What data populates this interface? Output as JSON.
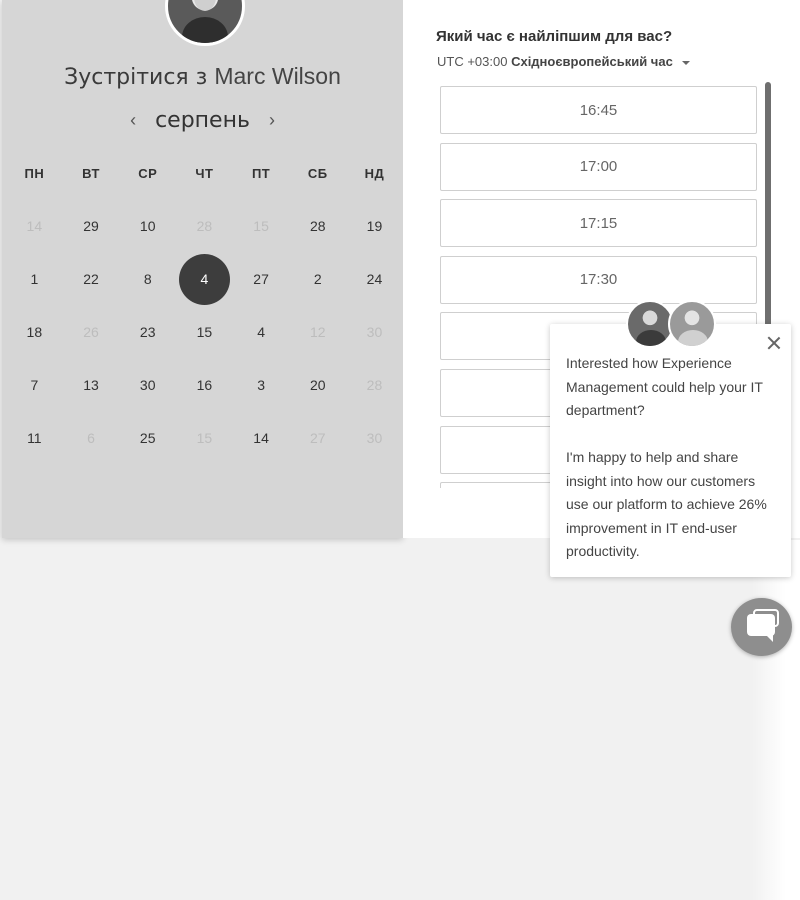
{
  "calendar": {
    "host_prefix": "Зустрітися з",
    "host_name": "Marc Wilson",
    "month": "серпень",
    "prev_arrow": "‹",
    "next_arrow": "›",
    "weekdays": [
      "ПН",
      "ВТ",
      "СР",
      "ЧТ",
      "ПТ",
      "СБ",
      "НД"
    ],
    "rows": [
      [
        {
          "d": "14",
          "m": true
        },
        {
          "d": "29"
        },
        {
          "d": "10"
        },
        {
          "d": "28",
          "m": true
        },
        {
          "d": "15",
          "m": true
        },
        {
          "d": "28"
        },
        {
          "d": "19"
        }
      ],
      [
        {
          "d": "1"
        },
        {
          "d": "22"
        },
        {
          "d": "8"
        },
        {
          "d": "4",
          "sel": true
        },
        {
          "d": "27"
        },
        {
          "d": "2"
        },
        {
          "d": "24"
        }
      ],
      [
        {
          "d": "18"
        },
        {
          "d": "26",
          "m": true
        },
        {
          "d": "23"
        },
        {
          "d": "15"
        },
        {
          "d": "4"
        },
        {
          "d": "12",
          "m": true
        },
        {
          "d": "30",
          "m": true
        }
      ],
      [
        {
          "d": "7"
        },
        {
          "d": "13"
        },
        {
          "d": "30"
        },
        {
          "d": "16"
        },
        {
          "d": "3"
        },
        {
          "d": "20"
        },
        {
          "d": "28",
          "m": true
        }
      ],
      [
        {
          "d": "11"
        },
        {
          "d": "6",
          "m": true
        },
        {
          "d": "25"
        },
        {
          "d": "15",
          "m": true
        },
        {
          "d": "14"
        },
        {
          "d": "27",
          "m": true
        },
        {
          "d": "30",
          "m": true
        }
      ]
    ]
  },
  "times": {
    "heading": "Який час є найліпшим для вас?",
    "tz_offset": "UTC +03:00",
    "tz_name": "Східноєвропейський час",
    "slots": [
      "16:45",
      "17:00",
      "17:15",
      "17:30",
      "",
      "",
      "",
      ""
    ]
  },
  "chat": {
    "paragraph1": "Interested how Experience Management could help your IT department?",
    "paragraph2": "I'm happy to help and share insight into how our customers use our platform to achieve 26% improvement in IT end-user productivity."
  }
}
